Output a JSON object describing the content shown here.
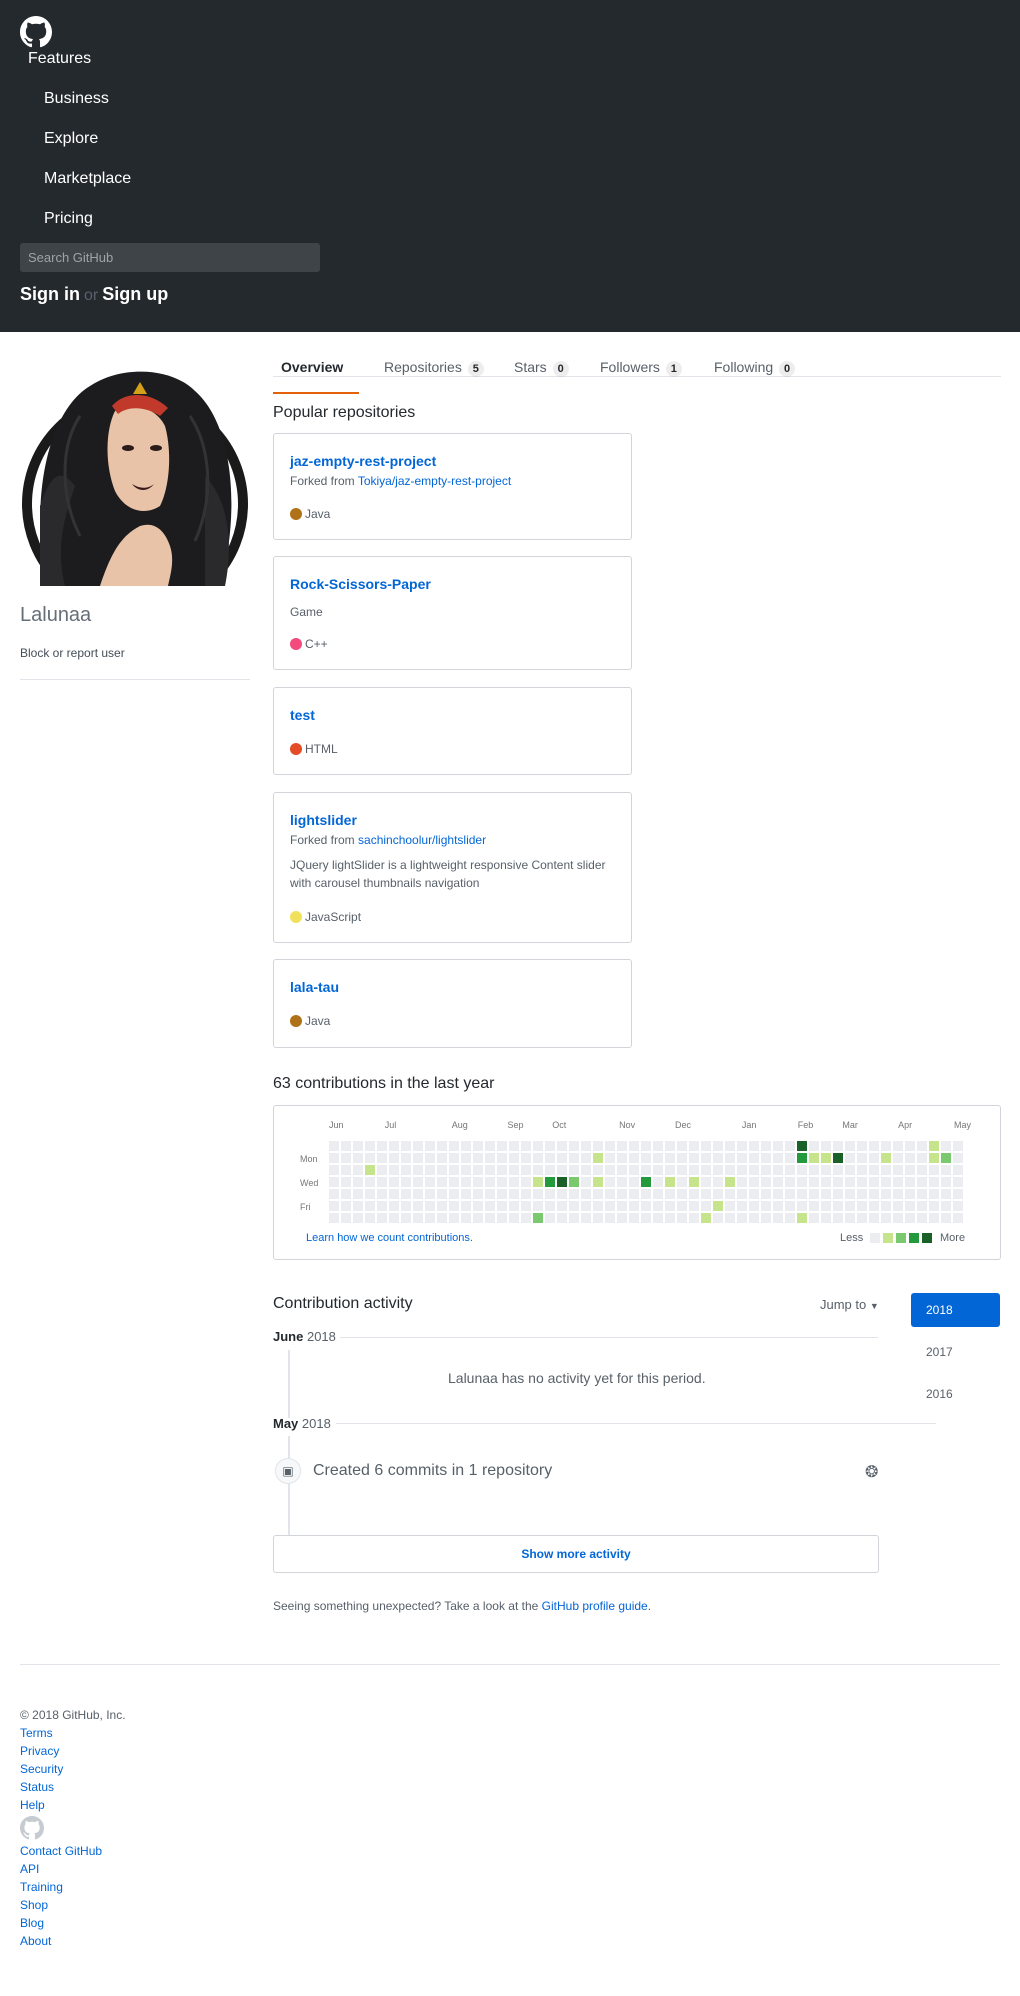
{
  "header": {
    "logo": "github-mark-icon",
    "nav": {
      "features": "Features",
      "items": [
        "Business",
        "Explore",
        "Marketplace",
        "Pricing"
      ]
    },
    "search_placeholder": "Search GitHub",
    "sign_in": "Sign in",
    "or": "or",
    "sign_up": "Sign up"
  },
  "profile": {
    "username": "Lalunaa",
    "block_user": "Block or report user"
  },
  "tabs": [
    {
      "label": "Overview"
    },
    {
      "label": "Repositories",
      "count": "5"
    },
    {
      "label": "Stars",
      "count": "0"
    },
    {
      "label": "Followers",
      "count": "1"
    },
    {
      "label": "Following",
      "count": "0"
    }
  ],
  "popular": {
    "title": "Popular repositories",
    "repos": [
      {
        "name": "jaz-empty-rest-project",
        "fork_prefix": "Forked from ",
        "fork_source": "Tokiya/jaz-empty-rest-project",
        "language": "Java",
        "lang_color": "#b07219"
      },
      {
        "name": "Rock-Scissors-Paper",
        "description": "Game",
        "language": "C++",
        "lang_color": "#f34b7d"
      },
      {
        "name": "test",
        "language": "HTML",
        "lang_color": "#e34c26"
      },
      {
        "name": "lightslider",
        "fork_prefix": "Forked from ",
        "fork_source": "sachinchoolur/lightslider",
        "description": "JQuery lightSlider is a lightweight responsive Content slider with carousel thumbnails navigation",
        "language": "JavaScript",
        "lang_color": "#f1e05a"
      },
      {
        "name": "lala-tau",
        "language": "Java",
        "lang_color": "#b07219"
      }
    ]
  },
  "contributions": {
    "title": "63 contributions in the last year",
    "months": [
      "Jun",
      "Jul",
      "Aug",
      "Sep",
      "Oct",
      "Nov",
      "Dec",
      "Jan",
      "Feb",
      "Mar",
      "Apr",
      "May"
    ],
    "days": [
      "Mon",
      "Wed",
      "Fri"
    ],
    "learn": "Learn how we count contributions.",
    "less": "Less",
    "more": "More",
    "colors": [
      "#ebedf0",
      "#c6e48b",
      "#7bc96f",
      "#239a3b",
      "#196127"
    ],
    "active_cells": [
      [
        3,
        2,
        1
      ],
      [
        17,
        3,
        1
      ],
      [
        18,
        3,
        3
      ],
      [
        19,
        3,
        4
      ],
      [
        20,
        3,
        2
      ],
      [
        17,
        6,
        2
      ],
      [
        22,
        1,
        1
      ],
      [
        22,
        3,
        1
      ],
      [
        26,
        3,
        3
      ],
      [
        28,
        3,
        1
      ],
      [
        30,
        3,
        1
      ],
      [
        31,
        6,
        1
      ],
      [
        32,
        5,
        1
      ],
      [
        33,
        3,
        1
      ],
      [
        39,
        0,
        4
      ],
      [
        39,
        1,
        3
      ],
      [
        40,
        1,
        1
      ],
      [
        41,
        1,
        1
      ],
      [
        42,
        1,
        4
      ],
      [
        39,
        6,
        1
      ],
      [
        46,
        1,
        1
      ],
      [
        50,
        0,
        1
      ],
      [
        50,
        1,
        1
      ],
      [
        51,
        1,
        2
      ]
    ]
  },
  "activity": {
    "title": "Contribution activity",
    "jump_to": "Jump to",
    "years": [
      "2018",
      "2017",
      "2016"
    ],
    "month1": "June",
    "year1": "2018",
    "no_activity": "Lalunaa has no activity yet for this period.",
    "month2": "May",
    "year2": "2018",
    "commits": "Created 6 commits in 1 repository",
    "show_more": "Show more activity",
    "unexpected_prefix": "Seeing something unexpected? Take a look at the ",
    "unexpected_link": "GitHub profile guide",
    "unexpected_suffix": "."
  },
  "footer": {
    "copyright": "© 2018 GitHub, Inc.",
    "links_top": [
      "Terms",
      "Privacy",
      "Security",
      "Status",
      "Help"
    ],
    "links_bottom": [
      "Contact GitHub",
      "API",
      "Training",
      "Shop",
      "Blog",
      "About"
    ]
  }
}
